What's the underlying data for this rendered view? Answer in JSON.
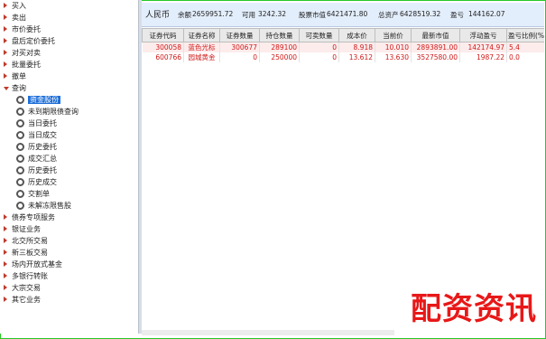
{
  "sidebar": {
    "items": [
      {
        "label": "买入",
        "kind": "root"
      },
      {
        "label": "卖出",
        "kind": "root"
      },
      {
        "label": "市价委托",
        "kind": "root"
      },
      {
        "label": "盘后定价委托",
        "kind": "root"
      },
      {
        "label": "对买对卖",
        "kind": "root"
      },
      {
        "label": "批量委托",
        "kind": "root"
      },
      {
        "label": "撤单",
        "kind": "root"
      },
      {
        "label": "查询",
        "kind": "root-open"
      },
      {
        "label": "资金股份",
        "kind": "child",
        "selected": true
      },
      {
        "label": "未到期限债查询",
        "kind": "child"
      },
      {
        "label": "当日委托",
        "kind": "child"
      },
      {
        "label": "当日成交",
        "kind": "child"
      },
      {
        "label": "历史委托",
        "kind": "child"
      },
      {
        "label": "成交汇总",
        "kind": "child"
      },
      {
        "label": "历史委托",
        "kind": "child"
      },
      {
        "label": "历史成交",
        "kind": "child"
      },
      {
        "label": "交割单",
        "kind": "child"
      },
      {
        "label": "未解冻限售股",
        "kind": "child"
      },
      {
        "label": "债券专项服务",
        "kind": "root"
      },
      {
        "label": "银证业务",
        "kind": "root"
      },
      {
        "label": "北交所交易",
        "kind": "root"
      },
      {
        "label": "新三板交易",
        "kind": "root"
      },
      {
        "label": "场内开放式基金",
        "kind": "root"
      },
      {
        "label": "多银行转账",
        "kind": "root"
      },
      {
        "label": "大宗交易",
        "kind": "root"
      },
      {
        "label": "其它业务",
        "kind": "root"
      }
    ]
  },
  "summary": {
    "currency": "人民币",
    "balance_label": "余额",
    "balance": "2659951.72",
    "available_label": "可用",
    "available": "3242.32",
    "stock_value_label": "股票市值",
    "stock_value": "6421471.80",
    "total_assets_label": "总资产",
    "total_assets": "6428519.32",
    "pnl_label": "盈亏",
    "pnl": "144162.07"
  },
  "table": {
    "columns": [
      "证券代码",
      "证券名称",
      "证券数量",
      "持仓数量",
      "可卖数量",
      "成本价",
      "当前价",
      "最新市值",
      "浮动盈亏",
      "盈亏比例(%)"
    ],
    "rows": [
      [
        "300058",
        "蓝色光标",
        "300677",
        "289100",
        "0",
        "8.918",
        "10.010",
        "2893891.00",
        "142174.97",
        "5.4"
      ],
      [
        "600766",
        "园城黄金",
        "0",
        "250000",
        "0",
        "13.612",
        "13.630",
        "3527580.00",
        "1987.22",
        "0.0"
      ]
    ]
  },
  "watermark": "配资资讯",
  "colors": {
    "accent": "#1e6fd9",
    "row_text": "#d01818",
    "summary_bg": "#e3eefc",
    "border": "#28c828"
  }
}
